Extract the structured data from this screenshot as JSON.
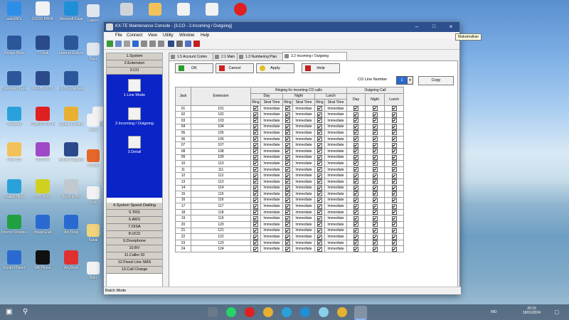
{
  "desktop": {
    "icons": [
      {
        "label": "astroDEV",
        "color": "#2d8ee8"
      },
      {
        "label": "GOOD BANK",
        "color": "#f2f2f2"
      },
      {
        "label": "Microsoft Edge",
        "color": "#1f8fd6"
      },
      {
        "label": "Resign Mem",
        "color": "#2b579a"
      },
      {
        "label": "IT Desk",
        "color": "#2a4a8a"
      },
      {
        "label": "Internet Rakyat",
        "color": "#2b579a"
      },
      {
        "label": "Command Center",
        "color": "#2b579a"
      },
      {
        "label": "PRABU PCR",
        "color": "#2a4a8a"
      },
      {
        "label": "KX-TE Maintenance",
        "color": "#2b579a"
      },
      {
        "label": "Telegram",
        "color": "#2aa1da"
      },
      {
        "label": "PRABU PCR Final",
        "color": "#e02020"
      },
      {
        "label": "Google Chrome",
        "color": "#e8b030"
      },
      {
        "label": "Gen NFT",
        "color": "#f2f2f2"
      },
      {
        "label": "Files SIS",
        "color": "#f2c25a"
      },
      {
        "label": "OLS File",
        "color": "#a049c8"
      },
      {
        "label": "Activity Register",
        "color": "#2a4a8a"
      },
      {
        "label": "Ruang Hijau",
        "color": "#2aa1da"
      },
      {
        "label": "PDF Form",
        "color": "#d0d020"
      },
      {
        "label": "Recycle Bin",
        "color": "#c0c8d0"
      },
      {
        "label": "Internet Download",
        "color": "#20a040"
      },
      {
        "label": "ImageGrab",
        "color": "#2a6ad0"
      },
      {
        "label": "AnyDesk",
        "color": "#2a6ad0"
      },
      {
        "label": "Kontrol Panel",
        "color": "#2a6ad0"
      },
      {
        "label": "WA Phone",
        "color": "#111111"
      },
      {
        "label": "AnyDesk",
        "color": "#e03030"
      }
    ]
  },
  "window": {
    "title": "KX-TE Maintenance Console - [3.CO - 2.Incoming / Outgoing]",
    "menu": [
      "File",
      "Connect",
      "View",
      "Utility",
      "Window",
      "Help"
    ],
    "tooltip": "Maksimalkan",
    "nav": {
      "top_items": [
        "1.System",
        "2.Extension",
        "3.CO"
      ],
      "sub_items": [
        "1.Line Mode",
        "2.Incoming / Outgoing",
        "3.Detail"
      ],
      "bottom_items": [
        "4.System Speed Dialling",
        "5.TRS",
        "6.ARS",
        "7.DISA",
        "8.UCD",
        "9.Doorphone",
        "10.BV",
        "11.Caller ID",
        "12.Fixed Line SMS",
        "13.Call Charge"
      ]
    },
    "tabs": [
      "1.5 Account Codes",
      "2.1 Main",
      "1.3 Numbering Plan",
      "3.2 Incoming / Outgoing"
    ],
    "buttons": {
      "ok": "OK",
      "cancel": "Cancel",
      "apply": "Apply",
      "help": "Help",
      "copy": "Copy"
    },
    "co_line_label": "CO Line Number",
    "co_line_value": "1",
    "grid": {
      "group_ringing": "Ringing for incoming CO calls",
      "group_outgoing": "Outgoing Call",
      "col_jack": "Jack",
      "col_extension": "Extension",
      "periods": [
        "Day",
        "Night",
        "Lunch"
      ],
      "sub_ring": "Ring",
      "sub_start": "Strat Time",
      "delay_value": "Immediate",
      "rows": [
        {
          "jack": "01",
          "ext": "101"
        },
        {
          "jack": "02",
          "ext": "102"
        },
        {
          "jack": "03",
          "ext": "103"
        },
        {
          "jack": "04",
          "ext": "104"
        },
        {
          "jack": "05",
          "ext": "105"
        },
        {
          "jack": "06",
          "ext": "106"
        },
        {
          "jack": "07",
          "ext": "107"
        },
        {
          "jack": "08",
          "ext": "108"
        },
        {
          "jack": "09",
          "ext": "109"
        },
        {
          "jack": "10",
          "ext": "110"
        },
        {
          "jack": "11",
          "ext": "111"
        },
        {
          "jack": "12",
          "ext": "112"
        },
        {
          "jack": "13",
          "ext": "113"
        },
        {
          "jack": "14",
          "ext": "114"
        },
        {
          "jack": "15",
          "ext": "115"
        },
        {
          "jack": "16",
          "ext": "116"
        },
        {
          "jack": "17",
          "ext": "117"
        },
        {
          "jack": "18",
          "ext": "118"
        },
        {
          "jack": "19",
          "ext": "119"
        },
        {
          "jack": "20",
          "ext": "120"
        },
        {
          "jack": "21",
          "ext": "121"
        },
        {
          "jack": "22",
          "ext": "122"
        },
        {
          "jack": "23",
          "ext": "123"
        },
        {
          "jack": "24",
          "ext": "124"
        }
      ]
    },
    "status_text": "Batch Mode"
  },
  "taskbar": {
    "apps": [
      "task-view",
      "whatsapp",
      "opera",
      "chrome",
      "telegram",
      "messenger",
      "chrome-2",
      "kx-te-console"
    ],
    "tray_lang": "IND",
    "time": "20:16",
    "date": "18/01/2024"
  }
}
